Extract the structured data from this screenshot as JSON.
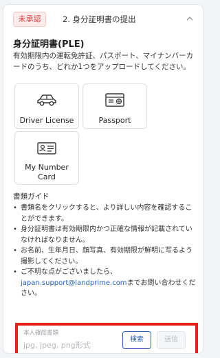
{
  "step": {
    "badge": "未承認",
    "title": "2. 身分証明書の提出"
  },
  "section": {
    "title": "身分証明書(PLE)",
    "description": "有効期限内の運転免許証、パスポート、マイナンバーカードのうち、どれか1つをアップロードしてください。"
  },
  "documents": {
    "driver_license": "Driver License",
    "passport": "Passport",
    "my_number_line1": "My Number",
    "my_number_line2": "Card"
  },
  "guide": {
    "title": "書類ガイド",
    "items": [
      "書類名をクリックすると、より詳しい内容を確認することができます。",
      "身分証明書は有効期限内かつ正確な情報が記載されていなければなりません。",
      "お名前、生年月日、顔写真、有効期限が鮮明に写るよう撮影してください。"
    ],
    "contact_prefix": "ご不明な点がございましたら、",
    "contact_email": "japan.support@landprime.com",
    "contact_suffix": "までお問い合わせください。"
  },
  "upload": {
    "label": "本人確認書類",
    "placeholder": "jpg, jpeg, png形式",
    "search_label": "検索",
    "send_label": "送信"
  },
  "colors": {
    "badge_red": "#e03a3a",
    "link_blue": "#1f5fbf",
    "highlight_red": "#e8201c"
  }
}
